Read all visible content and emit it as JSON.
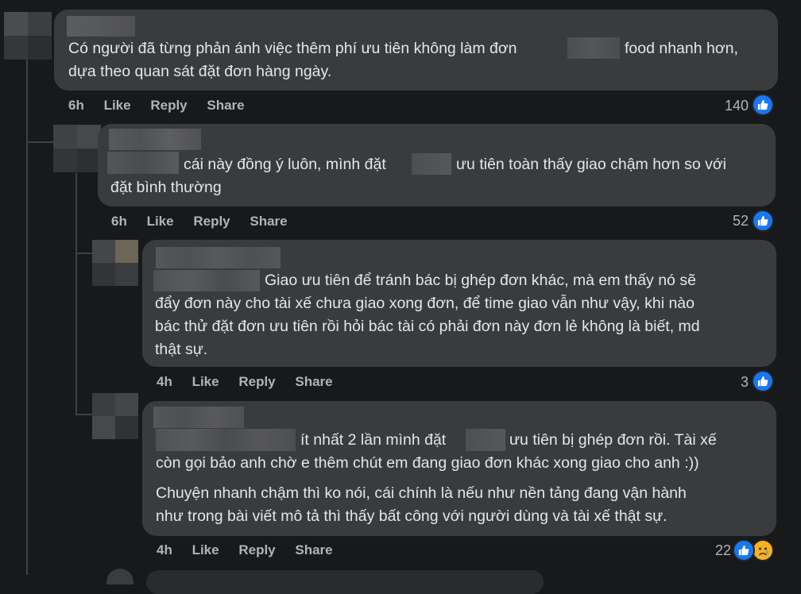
{
  "comments": [
    {
      "text_lines": [
        [
          "Có người đã từng phản ánh việc thêm phí ưu tiên không làm đơn",
          "food nhanh hơn,"
        ],
        [
          "dựa theo quan sát đặt đơn hàng ngày."
        ]
      ],
      "time": "6h",
      "like": "Like",
      "reply": "Reply",
      "share": "Share",
      "reactions": "140"
    },
    {
      "text_lines": [
        [
          "cái này đồng ý luôn, mình đặt",
          "ưu tiên toàn thấy giao chậm hơn so với"
        ],
        [
          "đặt bình thường"
        ]
      ],
      "time": "6h",
      "like": "Like",
      "reply": "Reply",
      "share": "Share",
      "reactions": "52"
    },
    {
      "text_lines": [
        [
          "Giao ưu tiên để tránh bác bị ghép đơn khác, mà em thấy nó sẽ"
        ],
        [
          "đẩy đơn này cho tài xế chưa giao xong đơn, để time giao vẫn như vậy, khi nào"
        ],
        [
          "bác thử đặt đơn ưu tiên rồi hỏi bác tài có phải đơn này đơn lẻ không là biết, md"
        ],
        [
          "thật sự."
        ]
      ],
      "time": "4h",
      "like": "Like",
      "reply": "Reply",
      "share": "Share",
      "reactions": "3"
    },
    {
      "text_lines": [
        [
          "ít nhất 2 lần mình đặt",
          "ưu tiên bị ghép đơn rồi. Tài xế"
        ],
        [
          "còn gọi bảo anh chờ e thêm chút em đang giao đơn khác xong giao cho anh :))"
        ],
        [
          "Chuyện nhanh chậm thì ko nói, cái chính là nếu như nền tảng đang vận hành"
        ],
        [
          "như trong bài viết mô tả thì thấy bất công với người dùng và tài xế thật sự."
        ]
      ],
      "time": "4h",
      "like": "Like",
      "reply": "Reply",
      "share": "Share",
      "reactions": "22"
    }
  ],
  "colors": {
    "background": "#18191a",
    "bubble": "#3a3b3c",
    "text": "#e4e6eb",
    "meta": "#b0b3b8",
    "like_blue": "#1877f2",
    "sad_yellow": "#f7b125"
  },
  "icons": {
    "like": "thumbs-up-icon",
    "sad": "sad-face-icon"
  }
}
